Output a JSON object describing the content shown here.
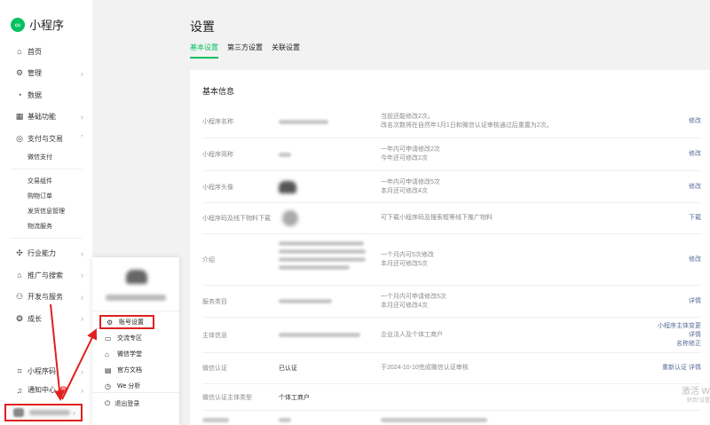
{
  "app": {
    "logo_text": "小程序"
  },
  "sidebar": {
    "items": [
      {
        "label": "首页"
      },
      {
        "label": "管理"
      },
      {
        "label": "数据"
      },
      {
        "label": "基础功能"
      },
      {
        "label": "支付与交易"
      }
    ],
    "pay_sub": [
      "微信支付"
    ],
    "trade_sub": [
      "交易组件",
      "购物订单",
      "发货信息管理",
      "物流服务"
    ],
    "more": [
      {
        "label": "行业能力"
      },
      {
        "label": "推广与搜索"
      },
      {
        "label": "开发与服务"
      },
      {
        "label": "成长"
      }
    ],
    "bottom": {
      "qrcode": "小程序码",
      "notice": "通知中心",
      "notice_count": "6"
    }
  },
  "popup": {
    "items": [
      "账号设置",
      "交流专区",
      "微信学堂",
      "官方文档",
      "We 分析"
    ],
    "logout": "退出登录"
  },
  "main": {
    "title": "设置",
    "tabs": [
      "基本设置",
      "第三方设置",
      "关联设置"
    ],
    "card_title": "基本信息",
    "rows": [
      {
        "label": "小程序名称",
        "desc1": "当前还能修改2次。",
        "desc2": "改名次数将在自然年1月1日和微信认证审核通过后重置为2次。",
        "action": "修改"
      },
      {
        "label": "小程序简称",
        "desc1": "一年内可申请修改2次",
        "desc2": "今年还可修改2次",
        "action": "修改"
      },
      {
        "label": "小程序头像",
        "desc1": "一年内可申请修改5次",
        "desc2": "本月还可修改4次",
        "action": "修改"
      },
      {
        "label": "小程序码及线下物料下载",
        "desc1": "可下载小程序码及搜索框等线下推广物料",
        "action": "下载"
      },
      {
        "label": "介绍",
        "desc1": "一个月内可5次修改",
        "desc2": "本月还可修改5次",
        "action": "修改"
      },
      {
        "label": "服务类目",
        "desc1": "一个月内可申请修改5次",
        "desc2": "本月还可修改4次",
        "action": "详情"
      },
      {
        "label": "主体信息",
        "desc1": "企业法人及个体工商户",
        "action1": "小程序主体变更",
        "action2": "详情",
        "action3": "名称修正"
      },
      {
        "label": "微信认证",
        "value": "已认证",
        "desc1": "于2024-10-10完成微信认证审核",
        "action": "重新认证  详情"
      },
      {
        "label": "微信认证主体类型",
        "value": "个体工商户"
      }
    ]
  },
  "watermark": {
    "line1": "激活 W",
    "line2": "转到\"设置"
  },
  "colors": {
    "accent": "#07c160",
    "link": "#576b95",
    "highlight": "#e02020"
  }
}
